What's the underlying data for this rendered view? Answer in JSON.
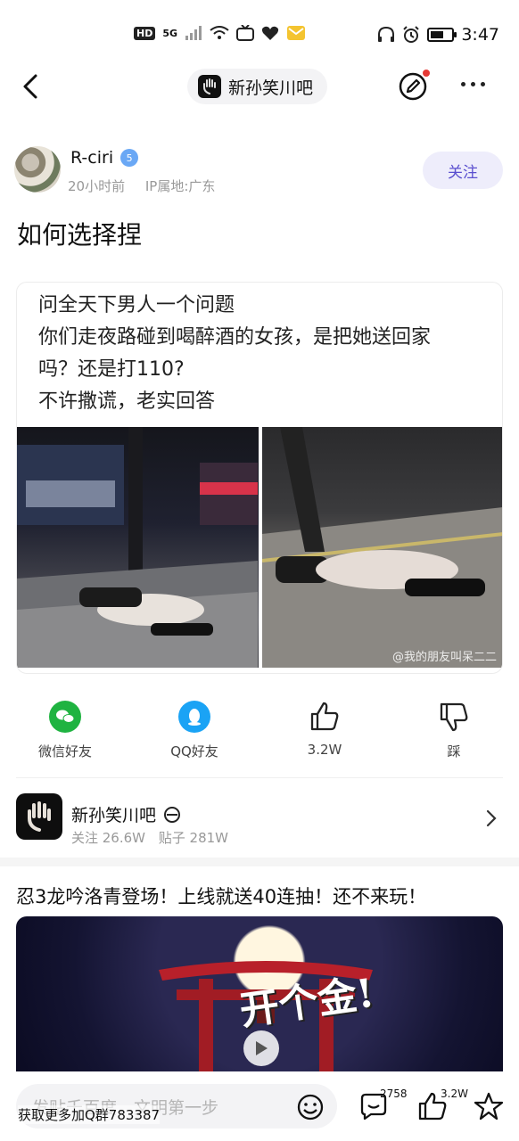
{
  "status_bar": {
    "hd": "HD",
    "network": "5G",
    "time": "3:47"
  },
  "nav": {
    "forum_name": "新孙笑川吧"
  },
  "author": {
    "name": "R-ciri",
    "level": "5",
    "time_ago": "20小时前",
    "ip_location": "IP属地:广东",
    "follow_label": "关注"
  },
  "post": {
    "title": "如何选择捏",
    "text_lines": [
      "问全天下男人一个问题",
      "你们走夜路碰到喝醉酒的女孩，是把她送回家",
      "吗？还是打110?",
      "不许撒谎，老实回答"
    ],
    "watermark": "@我的朋友叫呆二二"
  },
  "actions": {
    "wechat": "微信好友",
    "qq": "QQ好友",
    "likes": "3.2W",
    "dislike": "踩"
  },
  "forum": {
    "name": "新孙笑川吧",
    "followers": "关注 26.6W",
    "posts": "贴子 281W"
  },
  "ad": {
    "title": "忍3龙吟洛青登场！上线就送40连抽！还不来玩！",
    "overlay_text": "开个金!"
  },
  "bottom_bar": {
    "input_placeholder": "发贴千百度，文明第一步",
    "comment_count": "2758",
    "like_count": "3.2W"
  },
  "overlay_note": "获取更多加Q群783387"
}
